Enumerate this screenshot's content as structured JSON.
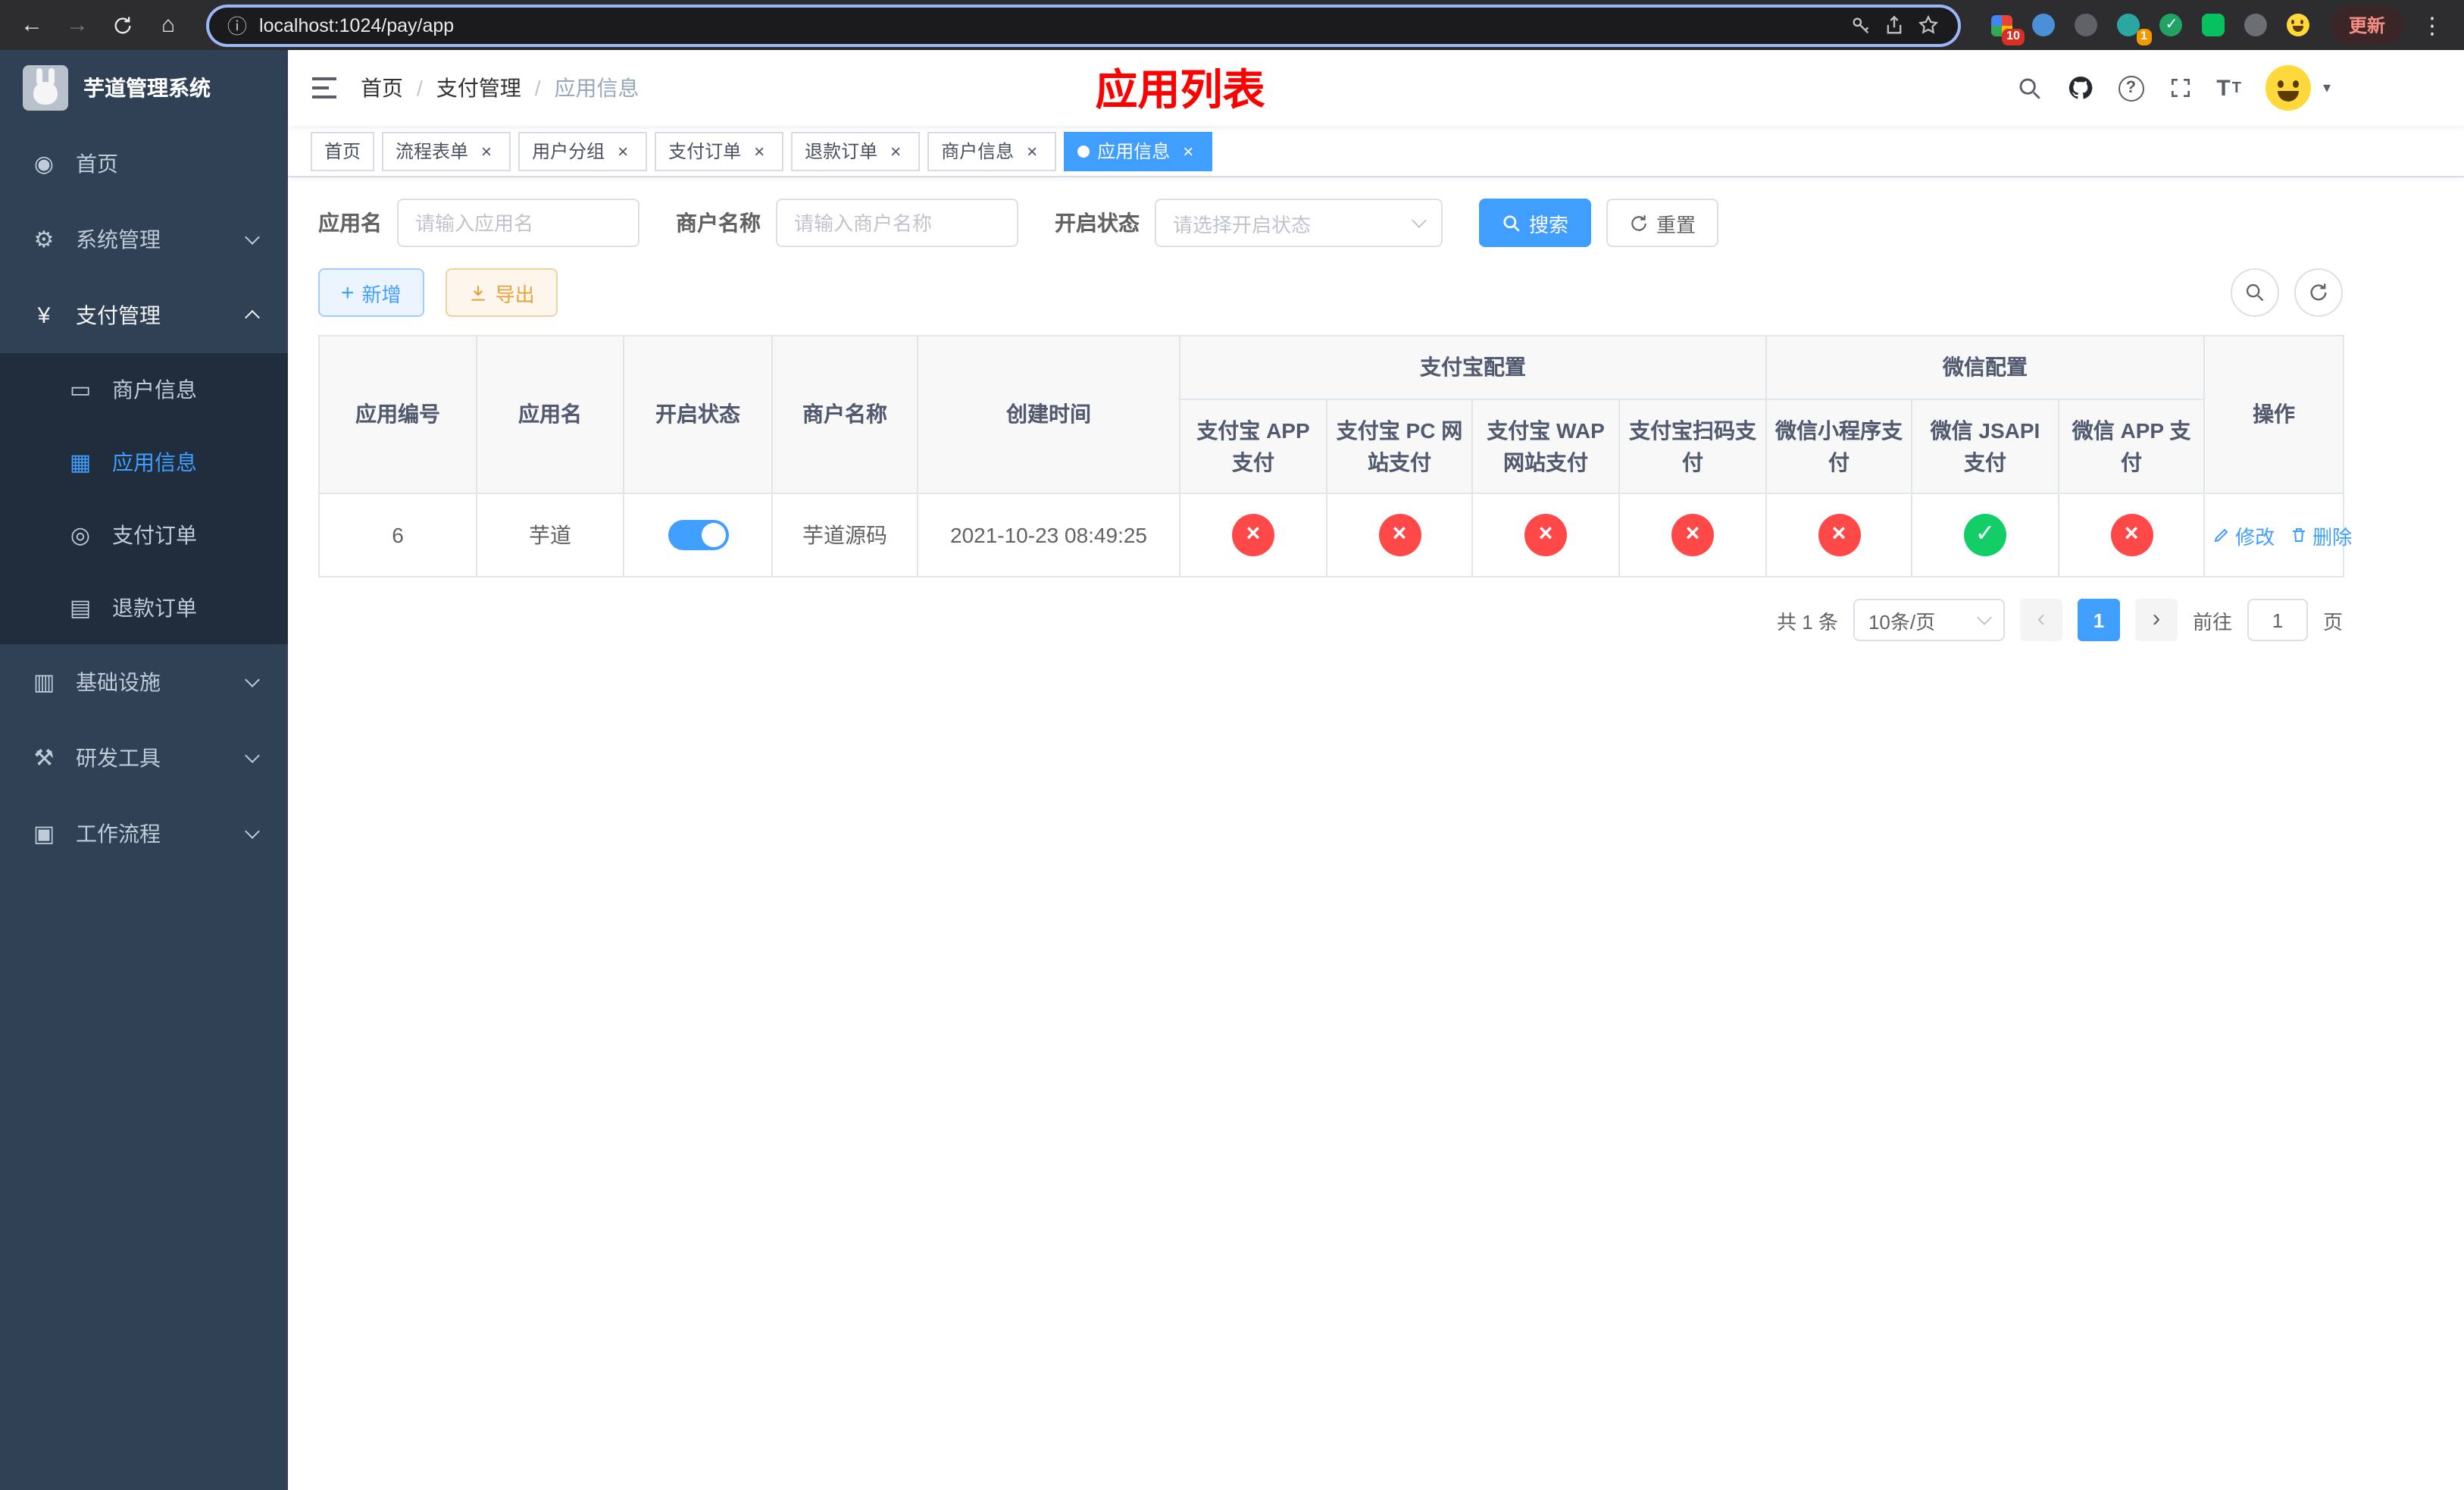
{
  "browser": {
    "url": "localhost:1024/pay/app",
    "update_label": "更新",
    "ext_badges": {
      "apps": "10",
      "profile": "1"
    }
  },
  "sidebar": {
    "title": "芋道管理系统",
    "items": [
      {
        "label": "首页"
      },
      {
        "label": "系统管理"
      },
      {
        "label": "支付管理"
      },
      {
        "label": "基础设施"
      },
      {
        "label": "研发工具"
      },
      {
        "label": "工作流程"
      }
    ],
    "submenu": [
      {
        "label": "商户信息"
      },
      {
        "label": "应用信息"
      },
      {
        "label": "支付订单"
      },
      {
        "label": "退款订单"
      }
    ]
  },
  "header": {
    "breadcrumb": [
      "首页",
      "支付管理",
      "应用信息"
    ],
    "separator": "/",
    "page_title": "应用列表"
  },
  "tabs": [
    {
      "label": "首页"
    },
    {
      "label": "流程表单"
    },
    {
      "label": "用户分组"
    },
    {
      "label": "支付订单"
    },
    {
      "label": "退款订单"
    },
    {
      "label": "商户信息"
    },
    {
      "label": "应用信息"
    }
  ],
  "filters": {
    "app_name_label": "应用名",
    "app_name_placeholder": "请输入应用名",
    "merchant_label": "商户名称",
    "merchant_placeholder": "请输入商户名称",
    "status_label": "开启状态",
    "status_placeholder": "请选择开启状态",
    "search_label": "搜索",
    "reset_label": "重置"
  },
  "toolbar": {
    "add_label": "新增",
    "export_label": "导出"
  },
  "table": {
    "simple": [
      "应用编号",
      "应用名",
      "开启状态",
      "商户名称",
      "创建时间"
    ],
    "groups": [
      {
        "label": "支付宝配置",
        "cols": [
          "支付宝 APP 支付",
          "支付宝 PC 网站支付",
          "支付宝 WAP 网站支付",
          "支付宝扫码支付"
        ]
      },
      {
        "label": "微信配置",
        "cols": [
          "微信小程序支付",
          "微信 JSAPI 支付",
          "微信 APP 支付"
        ]
      }
    ],
    "op": "操作",
    "row": {
      "id": "6",
      "name": "芋道",
      "enabled": true,
      "merchant": "芋道源码",
      "created": "2021-10-23 08:49:25",
      "channels": [
        false,
        false,
        false,
        false,
        false,
        true,
        false
      ],
      "edit_label": "修改",
      "delete_label": "删除"
    },
    "glyphs": {
      "check": "✓",
      "cross": "×"
    }
  },
  "pagination": {
    "total_text": "共 1 条",
    "page_size": "10条/页",
    "prev": "‹",
    "next": "›",
    "current_page": "1",
    "goto_label": "前往",
    "goto_value": "1",
    "page_unit": "页"
  },
  "icons": {
    "back": "←",
    "forward": "→",
    "home_nav": "⌂",
    "info": "ⓘ",
    "menu_kebab": "⋮",
    "close": "×",
    "caret_down": "▾",
    "plus": "+",
    "home": "◉",
    "system": "⚙",
    "pay": "¥",
    "merchant": "▭",
    "app": "▦",
    "order": "◎",
    "refund": "▤",
    "infra": "▥",
    "devtool": "⚒",
    "workflow": "▣",
    "question": "?",
    "font_big": "T",
    "font_small": "T"
  }
}
